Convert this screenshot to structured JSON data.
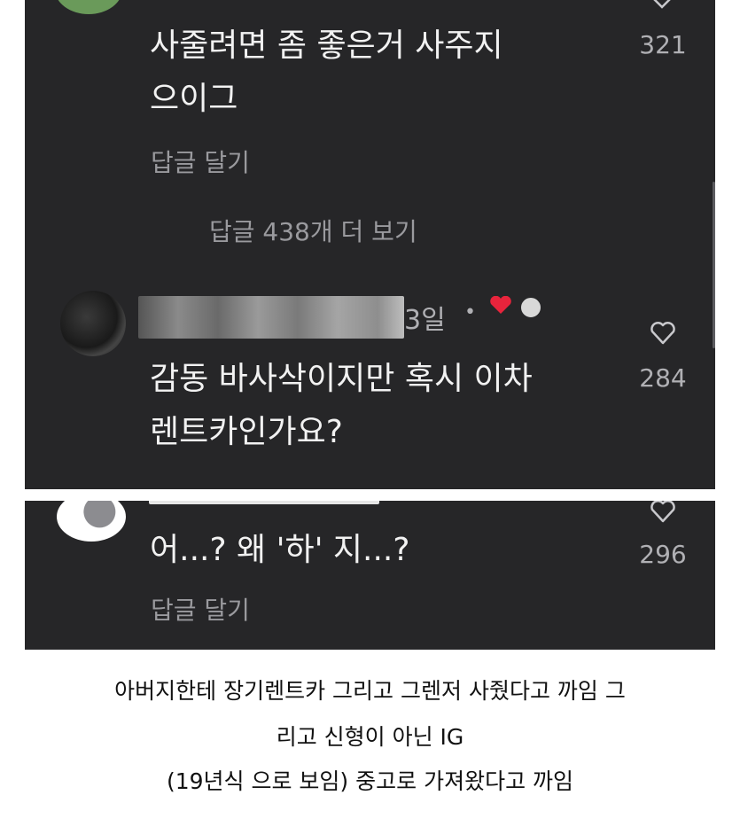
{
  "comment1": {
    "text_line1": "사줄려면 좀 좋은거 사주지",
    "text_line2": "으이그",
    "reply_label": "답글 달기",
    "like_count": "321"
  },
  "view_more_replies": "답글 438개 더 보기",
  "comment2": {
    "time": "3일",
    "separator": "•",
    "text_line1": "감동 바사삭이지만 혹시 이차",
    "text_line2": "렌트카인가요?",
    "like_count": "284"
  },
  "comment3": {
    "text_line1": "어...? 왜 '하' 지...?",
    "reply_label": "답글 달기",
    "like_count": "296"
  },
  "caption": {
    "line1": "아버지한테 장기렌트카 그리고 그렌저 사줬다고 까임 그",
    "line2": "리고 신형이 아닌 IG",
    "line3": "(19년식 으로 보임) 중고로 가져왔다고 까임"
  },
  "colors": {
    "panel_bg": "#262628",
    "text": "#f2f2f2",
    "muted": "#9a9a9e",
    "heart_red": "#e8243c"
  }
}
